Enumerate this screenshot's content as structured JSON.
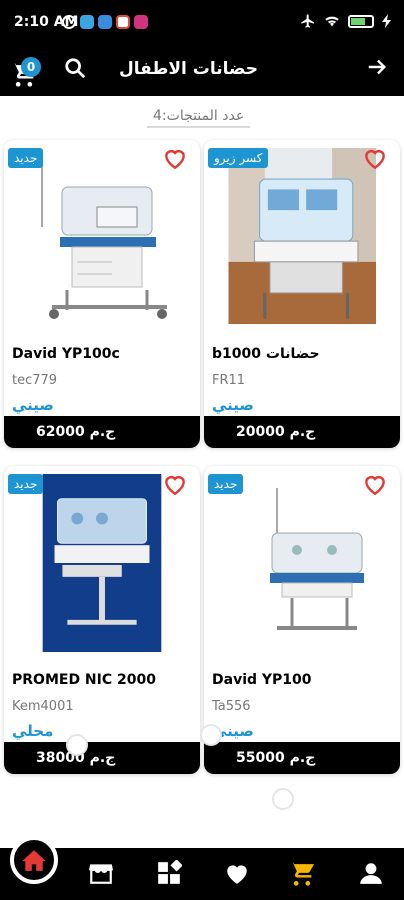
{
  "status_bar": {
    "time": "2:10 AM",
    "notification_icons": [
      "alarm-icon",
      "telegram-icon",
      "messenger-icon",
      "gmail-icon",
      "instagram-icon"
    ],
    "right_icons": [
      "airplane-icon",
      "wifi-icon",
      "battery-icon",
      "charging-icon"
    ]
  },
  "header": {
    "title": "حضانات الاطفال",
    "cart_count": "0",
    "search_icon": "search-icon",
    "back_icon": "arrow-right-icon"
  },
  "product_count_label": "عدد المنتجات:4",
  "products": [
    {
      "name": "b1000 حضانات",
      "code": "FR11",
      "origin": "صيني",
      "price": "20000 ج.م",
      "badge": "كسر زيرو"
    },
    {
      "name": "David YP100c",
      "code": "tec779",
      "origin": "صيني",
      "price": "62000 ج.م",
      "badge": "جديد"
    },
    {
      "name": "David YP100",
      "code": "Ta556",
      "origin": "صيني",
      "price": "55000 ج.م",
      "badge": "جديد"
    },
    {
      "name": "PROMED NIC 2000",
      "code": "Kem4001",
      "origin": "محلي",
      "price": "38000 ج.م",
      "badge": "جديد"
    }
  ],
  "bottom_nav": [
    "home-icon",
    "store-icon",
    "categories-icon",
    "heart-icon",
    "cart-icon",
    "profile-icon"
  ],
  "colors": {
    "accent": "#1d95d2",
    "home_active": "#e53935",
    "cart_nav": "#f5b700",
    "heart": "#e53935"
  }
}
